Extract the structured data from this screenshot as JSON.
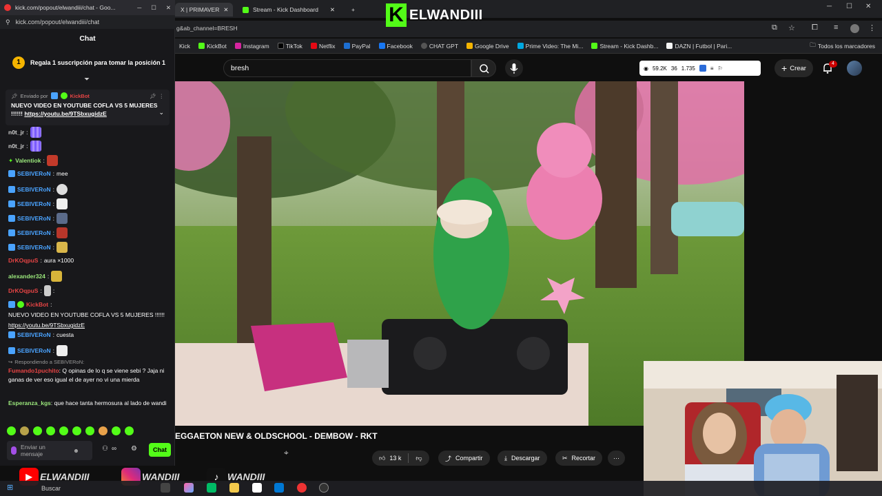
{
  "browser": {
    "chat_tab_title": "kick.com/popout/elwandiii/chat - Goo...",
    "chat_url": "kick.com/popout/elwandiii/chat",
    "tab2_title": "X | PRIMAVER",
    "tab3_title": "Stream - Kick Dashboard",
    "address_partial": "g&ab_channel=BRESH",
    "bookmarks": [
      "Kick",
      "KickBot",
      "Instagram",
      "TikTok",
      "Netflix",
      "PayPal",
      "Facebook",
      "CHAT GPT",
      "Google Drive",
      "Prime Video: The Mi...",
      "Stream - Kick Dashb...",
      "DAZN | Futbol | Pari..."
    ],
    "bookmarks_folder": "Todos los marcadores"
  },
  "chat": {
    "header": "Chat",
    "sub_goal_count": "1",
    "sub_goal_text": "Regala 1 suscripción para tomar la posición 1",
    "pinned_sent_by": "Enviado por",
    "pinned_sender": "KickBot",
    "pinned_text": "NUEVO VIDEO EN YOUTUBE COFLA VS 5 MUJERES !!!!!!",
    "pinned_link": "https://youtu.be/9TSbxugidzE",
    "messages": [
      {
        "user": "n0t_jr",
        "text": ""
      },
      {
        "user": "n0t_jr",
        "text": ""
      },
      {
        "user": "Valentiok",
        "text": ""
      },
      {
        "user": "SEBIVERoN",
        "text": "mee"
      },
      {
        "user": "SEBIVERoN",
        "text": ""
      },
      {
        "user": "SEBIVERoN",
        "text": ""
      },
      {
        "user": "SEBIVERoN",
        "text": ""
      },
      {
        "user": "SEBIVERoN",
        "text": ""
      },
      {
        "user": "SEBIVERoN",
        "text": ""
      },
      {
        "user": "DrKOqpuS",
        "text": "aura ×1000"
      },
      {
        "user": "alexander324",
        "text": ""
      },
      {
        "user": "DrKOqpuS",
        "text": ""
      },
      {
        "user": "KickBot",
        "text": "NUEVO VIDEO EN YOUTUBE COFLA VS 5 MUJERES !!!!!!",
        "link": "https://youtu.be/9TSbxugidzE"
      },
      {
        "user": "SEBIVERoN",
        "text": "cuesta"
      },
      {
        "user": "SEBIVERoN",
        "text": ""
      },
      {
        "reply_to": "Respondiendo a SEBIVERoN:",
        "user": "Fumando1puchito",
        "text": "Q opinas de lo q se viene sebi ? Jaja ni ganas de ver eso igual el de ayer no vi una mierda"
      },
      {
        "user": "Esperanza_kgs",
        "text": "que hace tanta hermosura al lado de wandi"
      }
    ],
    "input_placeholder": "Enviar un mensaje",
    "send_label": "Chat"
  },
  "youtube": {
    "search_value": "bresh",
    "stats": [
      "59.2K",
      "36",
      "1.735"
    ],
    "create_label": "Crear",
    "notifications": "4",
    "video_title": "EGGAETON NEW & OLDSCHOOL - DEMBOW - RKT",
    "likes": "13 k",
    "share_label": "Compartir",
    "download_label": "Descargar",
    "clip_label": "Recortar",
    "more_label": "···"
  },
  "overlay": {
    "kick_name": "ELWANDIII",
    "youtube_name": "ELWANDIII",
    "instagram_name": "WANDIII",
    "tiktok_name": "WANDIII"
  },
  "taskbar": {
    "search_label": "Buscar"
  },
  "colors": {
    "kick_green": "#53fc18",
    "chat_bg": "#18181b",
    "youtube_red": "#ff0000"
  }
}
